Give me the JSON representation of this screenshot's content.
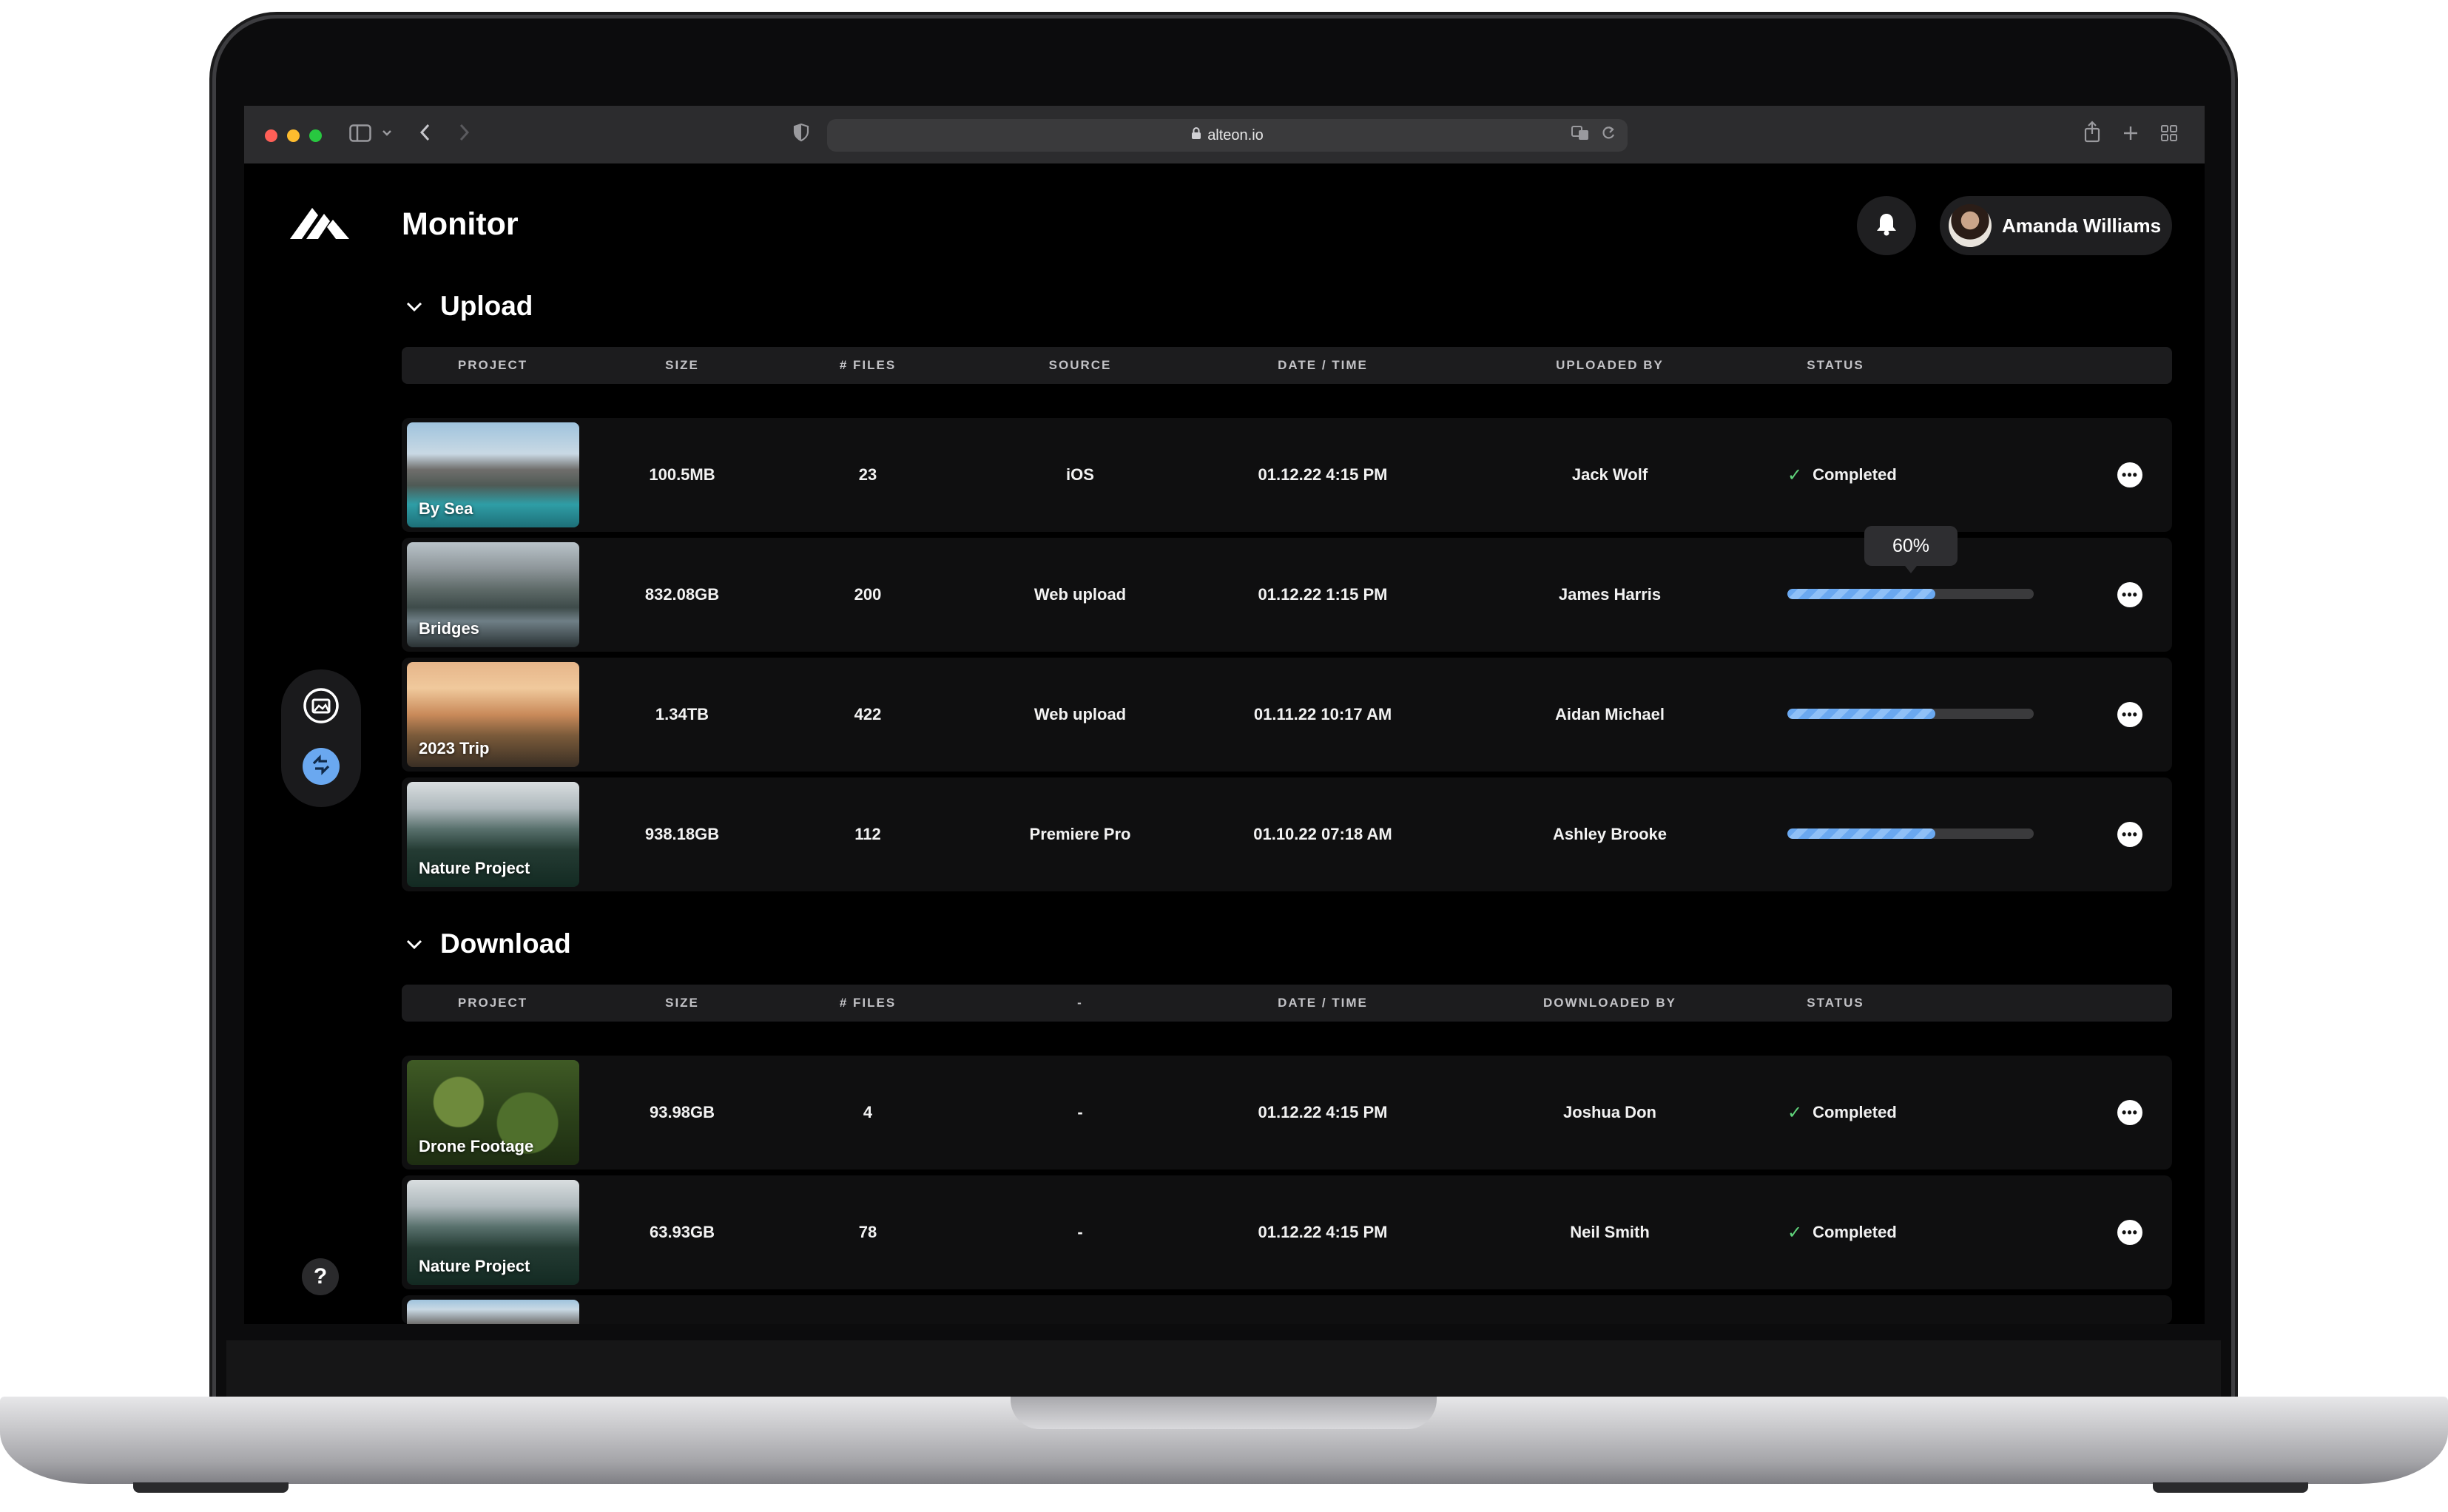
{
  "browser": {
    "url": "alteon.io"
  },
  "app": {
    "title": "Monitor"
  },
  "user": {
    "name": "Amanda Williams"
  },
  "help": {
    "label": "?"
  },
  "upload": {
    "title": "Upload",
    "columns": [
      "PROJECT",
      "SIZE",
      "# FILES",
      "SOURCE",
      "DATE / TIME",
      "UPLOADED BY",
      "STATUS"
    ],
    "rows": [
      {
        "project": "By Sea",
        "size": "100.5MB",
        "files": "23",
        "source": "iOS",
        "datetime": "01.12.22 4:15 PM",
        "by": "Jack Wolf",
        "status": "Completed"
      },
      {
        "project": "Bridges",
        "size": "832.08GB",
        "files": "200",
        "source": "Web upload",
        "datetime": "01.12.22 1:15 PM",
        "by": "James Harris",
        "progress": 0.6,
        "progress_label": "60%"
      },
      {
        "project": "2023 Trip",
        "size": "1.34TB",
        "files": "422",
        "source": "Web upload",
        "datetime": "01.11.22 10:17 AM",
        "by": "Aidan Michael",
        "progress": 0.6
      },
      {
        "project": "Nature Project",
        "size": "938.18GB",
        "files": "112",
        "source": "Premiere Pro",
        "datetime": "01.10.22 07:18 AM",
        "by": "Ashley Brooke",
        "progress": 0.6
      }
    ]
  },
  "download": {
    "title": "Download",
    "columns": [
      "PROJECT",
      "SIZE",
      "# FILES",
      "-",
      "DATE / TIME",
      "DOWNLOADED BY",
      "STATUS"
    ],
    "rows": [
      {
        "project": "Drone Footage",
        "size": "93.98GB",
        "files": "4",
        "source": "-",
        "datetime": "01.12.22 4:15 PM",
        "by": "Joshua Don",
        "status": "Completed"
      },
      {
        "project": "Nature Project",
        "size": "63.93GB",
        "files": "78",
        "source": "-",
        "datetime": "01.12.22 4:15 PM",
        "by": "Neil Smith",
        "status": "Completed"
      }
    ]
  },
  "icons": {
    "lock": "lock-icon",
    "bell": "bell-icon",
    "more": "more-icon",
    "check": "check-icon",
    "chevron": "chevron-down-icon",
    "gallery": "gallery-icon",
    "transfer": "transfer-icon"
  },
  "colors": {
    "accent": "#6aa8f0",
    "success": "#5fd27a",
    "background": "#000000"
  }
}
